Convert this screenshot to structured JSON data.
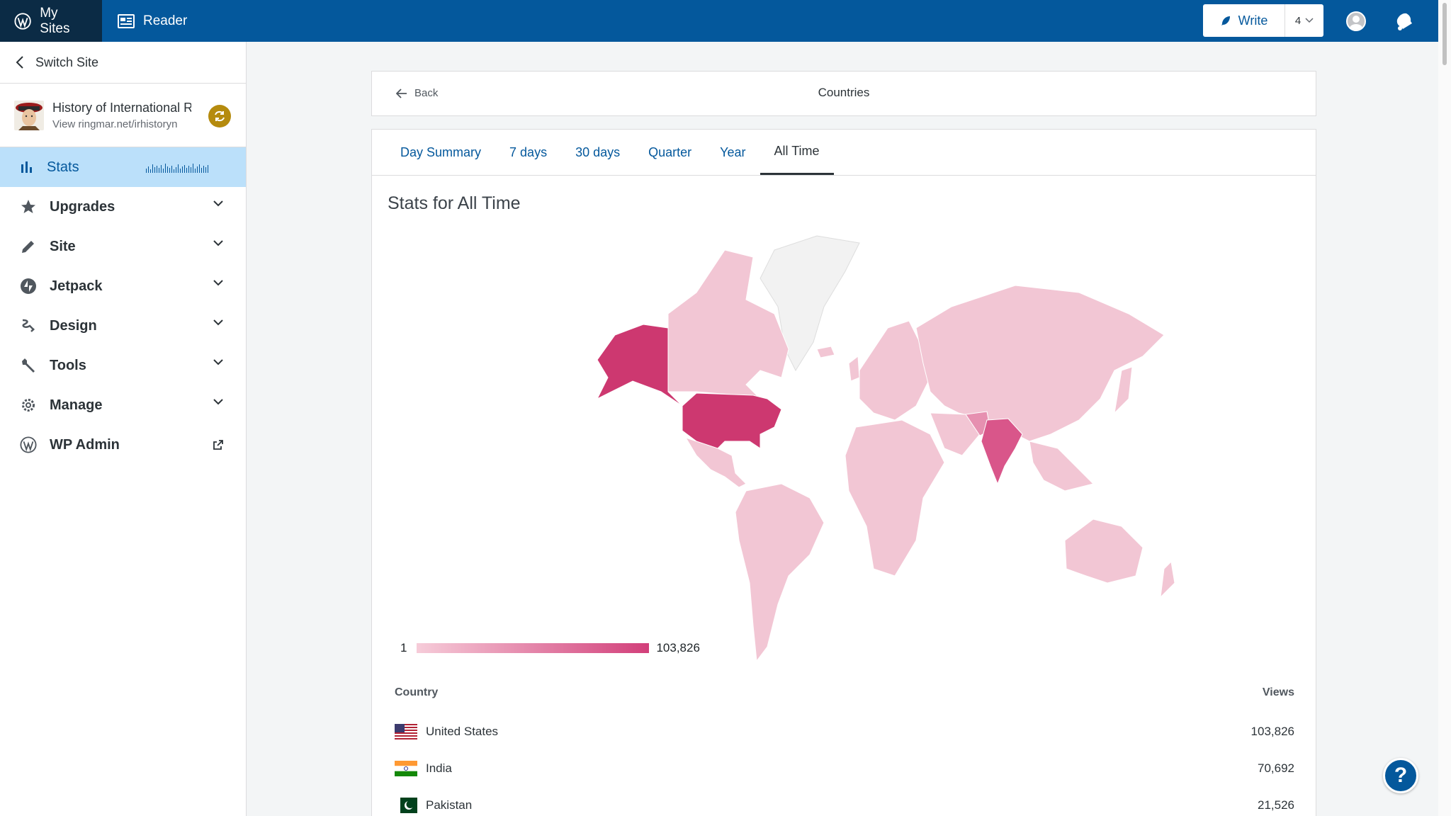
{
  "masterbar": {
    "my_sites": "My Sites",
    "reader": "Reader",
    "write": "Write",
    "draft_count": "4"
  },
  "sidebar": {
    "switch_site": "Switch Site",
    "site_title": "History of International Relations",
    "site_url": "View ringmar.net/irhistoryn",
    "items": [
      {
        "label": "Stats",
        "icon": "bar-chart-icon"
      },
      {
        "label": "Upgrades",
        "icon": "star-icon"
      },
      {
        "label": "Site",
        "icon": "pencil-icon"
      },
      {
        "label": "Jetpack",
        "icon": "jetpack-icon"
      },
      {
        "label": "Design",
        "icon": "brush-icon"
      },
      {
        "label": "Tools",
        "icon": "wrench-icon"
      },
      {
        "label": "Manage",
        "icon": "gear-icon"
      },
      {
        "label": "WP Admin",
        "icon": "wordpress-icon"
      }
    ]
  },
  "header": {
    "back": "Back",
    "title": "Countries"
  },
  "tabs": [
    "Day Summary",
    "7 days",
    "30 days",
    "Quarter",
    "Year",
    "All Time"
  ],
  "active_tab": "All Time",
  "stats_heading": "Stats for All Time",
  "legend": {
    "min": "1",
    "max": "103,826",
    "min_color": "#f6ccd9",
    "max_color": "#d23f7a"
  },
  "table": {
    "col_country": "Country",
    "col_views": "Views",
    "rows": [
      {
        "country": "United States",
        "views": "103,826"
      },
      {
        "country": "India",
        "views": "70,692"
      },
      {
        "country": "Pakistan",
        "views": "21,526"
      }
    ]
  },
  "colors": {
    "accent": "#04589c",
    "masterbar": "#04589c",
    "map_low": "#f2c6d4",
    "map_high": "#cd3870"
  }
}
